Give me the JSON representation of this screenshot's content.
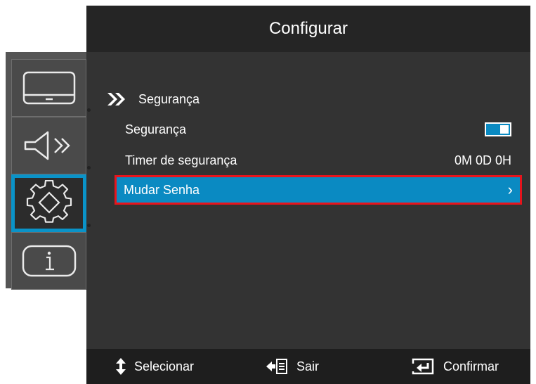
{
  "header": {
    "title": "Configurar"
  },
  "sidebar": {
    "items": [
      {
        "icon": "display-icon",
        "active": false
      },
      {
        "icon": "audio-icon",
        "active": false
      },
      {
        "icon": "settings-gear-icon",
        "active": true
      },
      {
        "icon": "info-icon",
        "active": false
      }
    ]
  },
  "section": {
    "title": "Segurança",
    "icon": "double-chevron-right-icon"
  },
  "rows": [
    {
      "label": "Segurança",
      "control": "toggle",
      "toggle_state": "on"
    },
    {
      "label": "Timer de segurança",
      "value": "0M 0D 0H"
    },
    {
      "label": "Mudar Senha",
      "value": "›",
      "selected": true
    }
  ],
  "footer": {
    "select_label": "Selecionar",
    "exit_label": "Sair",
    "confirm_label": "Confirmar"
  },
  "colors": {
    "accent": "#0a8ac2",
    "highlight_border": "#e8141c",
    "panel_bg": "#333333",
    "header_bg": "#252525"
  }
}
